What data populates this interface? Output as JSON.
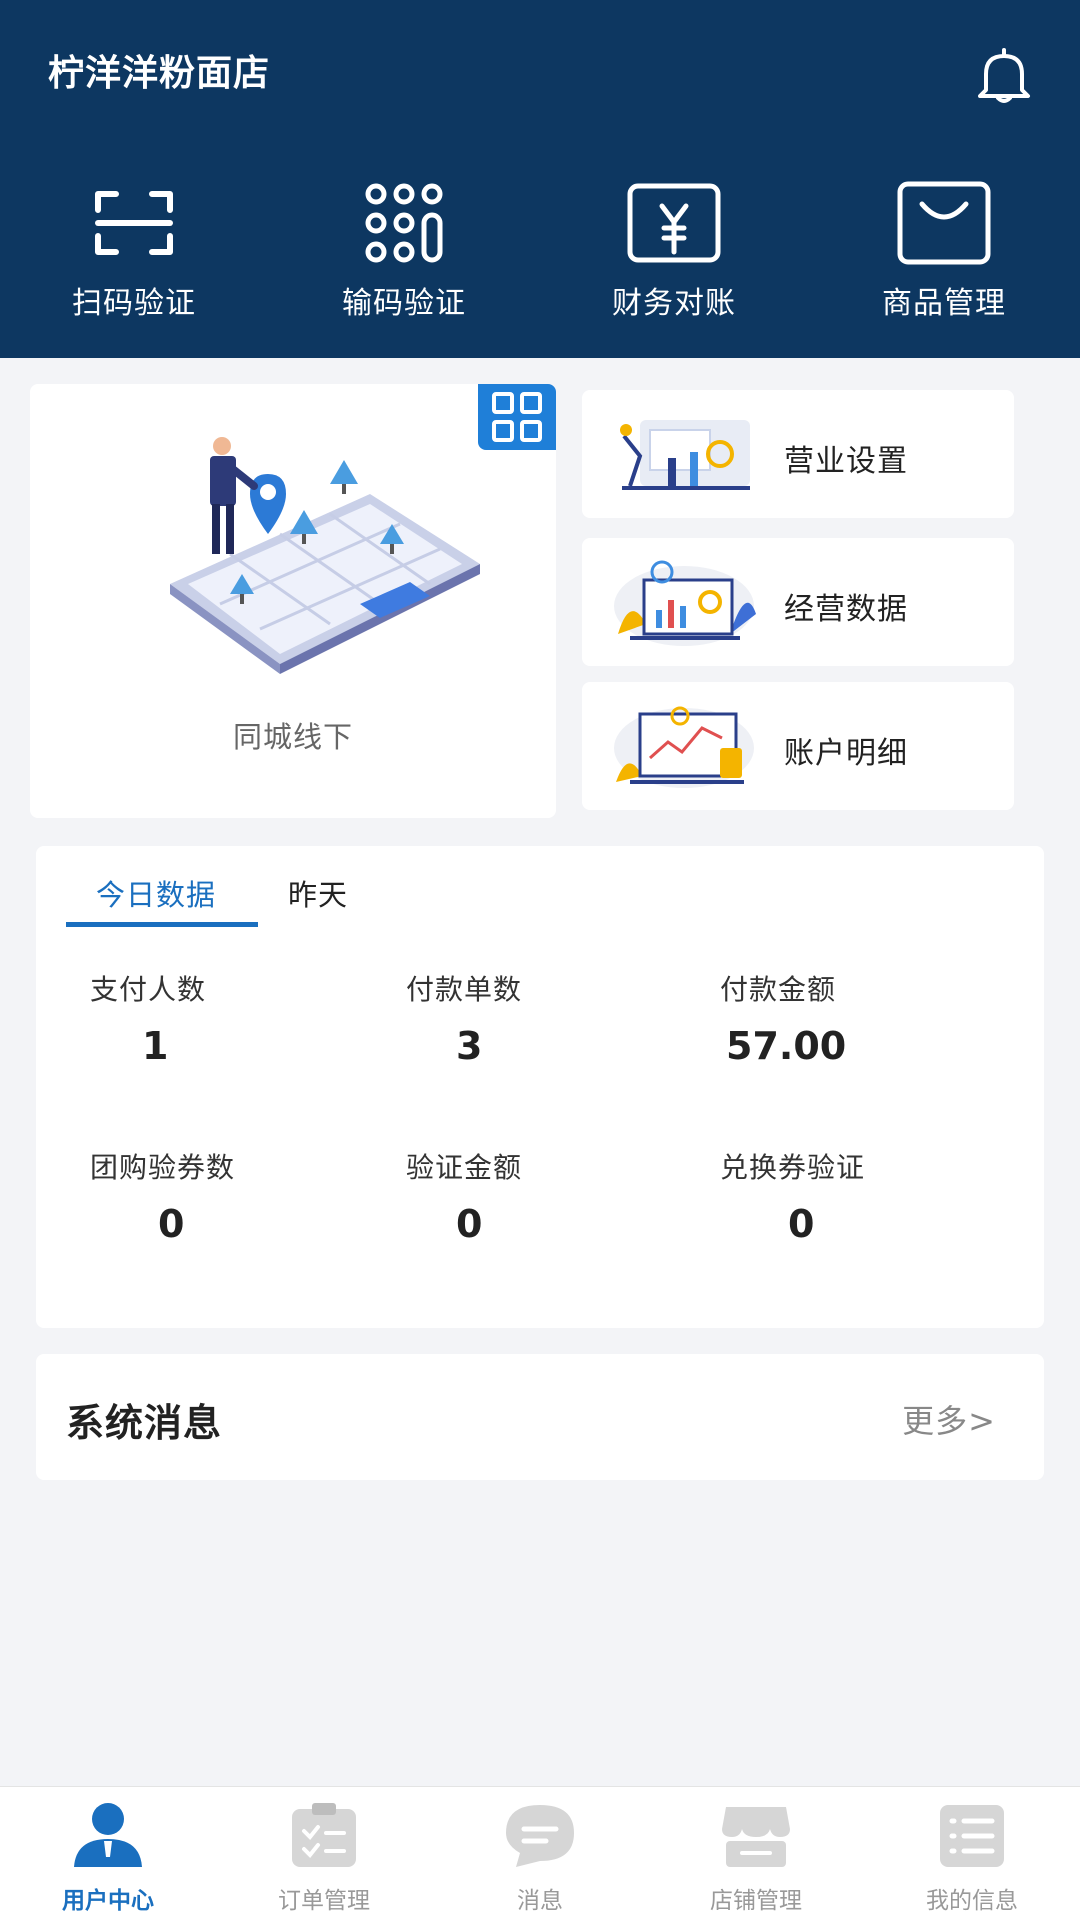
{
  "header": {
    "store_name": "柠洋洋粉面店",
    "quick_actions": [
      {
        "label": "扫码验证",
        "icon": "scan-icon"
      },
      {
        "label": "输码验证",
        "icon": "keypad-icon"
      },
      {
        "label": "财务对账",
        "icon": "wallet-yen-icon"
      },
      {
        "label": "商品管理",
        "icon": "shopping-bag-icon"
      }
    ]
  },
  "features": {
    "big_card": {
      "label": "同城线下"
    },
    "side_cards": [
      {
        "label": "营业设置"
      },
      {
        "label": "经营数据"
      },
      {
        "label": "账户明细"
      }
    ]
  },
  "stats": {
    "tabs": [
      "今日数据",
      "昨天"
    ],
    "active_tab": 0,
    "items": [
      {
        "label": "支付人数",
        "value": "1"
      },
      {
        "label": "付款单数",
        "value": "3"
      },
      {
        "label": "付款金额",
        "value": "57.00"
      },
      {
        "label": "团购验券数",
        "value": "0"
      },
      {
        "label": "验证金额",
        "value": "0"
      },
      {
        "label": "兑换券验证",
        "value": "0"
      }
    ]
  },
  "system_messages": {
    "title": "系统消息",
    "more": "更多>"
  },
  "bottom_nav": {
    "items": [
      {
        "label": "用户中心",
        "icon": "user-icon"
      },
      {
        "label": "订单管理",
        "icon": "clipboard-icon"
      },
      {
        "label": "消息",
        "icon": "chat-bubble-icon"
      },
      {
        "label": "店铺管理",
        "icon": "store-icon"
      },
      {
        "label": "我的信息",
        "icon": "list-icon"
      }
    ],
    "active": 0
  },
  "colors": {
    "header_bg": "#0d3761",
    "accent": "#1a6fbf",
    "page_bg": "#f3f4f7"
  }
}
